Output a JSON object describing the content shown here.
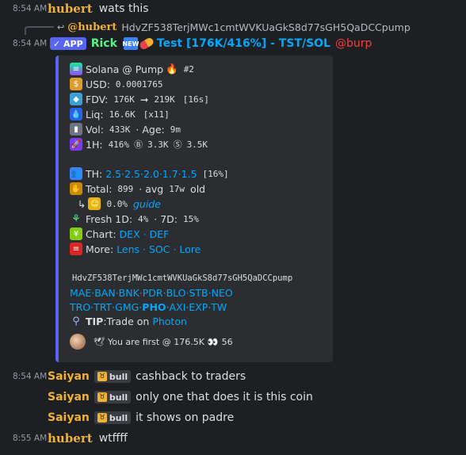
{
  "messages": [
    {
      "time": "8:54 AM",
      "user": "hubert",
      "text": "wats this"
    },
    {
      "reply": {
        "user": "@hubert",
        "text": "HdvZF538TerjMWc1cmtWVKUaGkS8d77sGH5QaDCCpump"
      }
    },
    {
      "time": "8:54 AM",
      "app_badge": "APP",
      "user": "Rick",
      "title": "Test [176K/416%] - TST/SOL",
      "mention": "@burp"
    }
  ],
  "embed": {
    "line1": "Solana @ Pump",
    "rank": "#2",
    "usd_label": "USD:",
    "usd": "0.0001765",
    "fdv_label": "FDV:",
    "fdv_from": "176K",
    "fdv_to": "219K",
    "fdv_time": "[16s]",
    "liq_label": "Liq:",
    "liq": "16.6K",
    "liq_mult": "[x11]",
    "vol_label": "Vol:",
    "vol": "433K",
    "age_label": "· Age:",
    "age": "9m",
    "h1_label": "1H:",
    "h1_pct": "416%",
    "h1_buys": "3.3K",
    "h1_sells": "3.5K",
    "th_label": "TH:",
    "th_values": "2.5·2.5·2.0·1.7·1.5",
    "th_total": "[16%]",
    "total_label": "Total:",
    "total": "899",
    "avg_label": "· avg",
    "avg": "17w",
    "old": "old",
    "dev_pct": "0.0%",
    "guide": "guide",
    "fresh_label": "Fresh 1D:",
    "fresh_1d": "4%",
    "fresh_7d_label": "· 7D:",
    "fresh_7d": "15%",
    "chart_label": "Chart:",
    "chart_links": "DEX · DEF",
    "more_label": "More:",
    "more_links": "Lens · SOC · Lore",
    "address": "HdvZF538TerjMWc1cmtWVKUaGkS8d77sGH5QaDCCpump",
    "links1": "MAE·BAN·BNK·PDR·BLO·STB·NEO",
    "links2a": "TRO·TRT·GMG·",
    "links2b": "PHO",
    "links2c": "·AXI·EXP·TW",
    "tip_label": "TIP",
    "tip_text": ":Trade on",
    "tip_link": "Photon",
    "footer": "You are first @ 176.5K",
    "footer_count": "56"
  },
  "chat": [
    {
      "time": "8:54 AM",
      "user": "Saiyan",
      "badge": "bull",
      "text": "cashback to traders"
    },
    {
      "user": "Saiyan",
      "badge": "bull",
      "text": "only one that does it is this coin"
    },
    {
      "user": "Saiyan",
      "badge": "bull",
      "text": "it shows on padre"
    },
    {
      "time": "8:55 AM",
      "user": "hubert",
      "text": "wtffff"
    }
  ],
  "colors": {
    "accent": "#5865f2",
    "username": "#f0b232",
    "link": "#00a8fc",
    "mention": "#c9cdfb"
  }
}
